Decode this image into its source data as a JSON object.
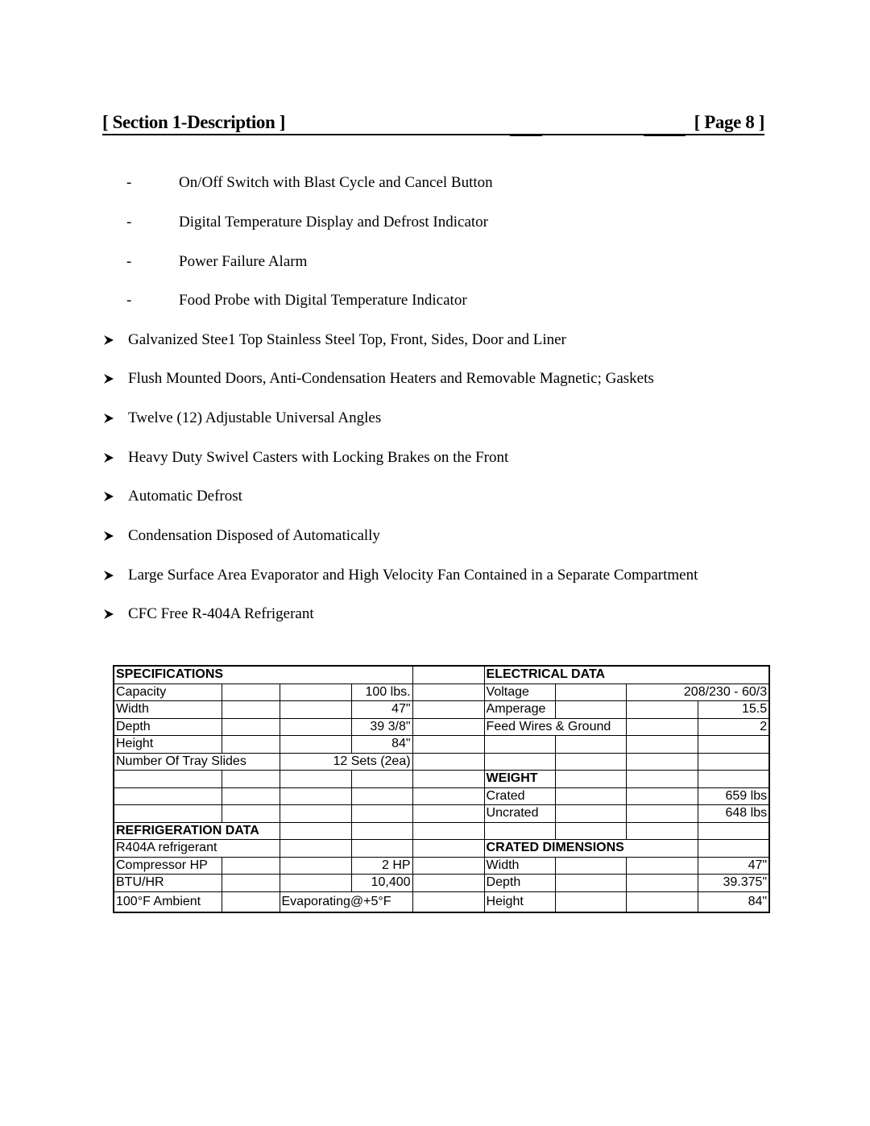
{
  "header": {
    "section": "[ Section 1-Description ]",
    "page": "[ Page 8 ]"
  },
  "sub_features": [
    "On/Off Switch with Blast Cycle and Cancel Button",
    "Digital Temperature Display and Defrost Indicator",
    "Power Failure Alarm",
    "Food Probe with Digital Temperature Indicator"
  ],
  "sub_feature_marker": "-",
  "features": [
    "Galvanized Stee1 Top Stainless Steel Top, Front, Sides, Door and Liner",
    "Flush Mounted Doors, Anti-Condensation Heaters and Removable Magnetic; Gaskets",
    "Twelve (12) Adjustable Universal Angles",
    "Heavy Duty Swivel Casters with Locking Brakes on the Front",
    "Automatic Defrost",
    "Condensation Disposed of Automatically",
    "Large Surface Area Evaporator and High Velocity Fan Contained in a Separate Compartment",
    "CFC Free R-404A Refrigerant"
  ],
  "feature_marker_icon": "arrowhead-bullet-icon",
  "table": {
    "specifications": {
      "title": "SPECIFICATIONS",
      "rows": [
        {
          "label": "Capacity",
          "value": "100 lbs."
        },
        {
          "label": "Width",
          "value": "47\""
        },
        {
          "label": "Depth",
          "value": "39 3/8\""
        },
        {
          "label": "Height",
          "value": "84\""
        },
        {
          "label": "Number Of Tray Slides",
          "value": "12 Sets (2ea)"
        }
      ]
    },
    "refrigeration": {
      "title": "REFRIGERATION DATA",
      "refrigerant": "R404A refrigerant",
      "rows": [
        {
          "label": "Compressor HP",
          "value": "2 HP"
        },
        {
          "label": "BTU/HR",
          "value": "10,400"
        },
        {
          "label": "100°F Ambient",
          "value": "Evaporating@+5°F"
        }
      ]
    },
    "electrical": {
      "title": "ELECTRICAL DATA",
      "rows": [
        {
          "label": "Voltage",
          "value": "208/230  - 60/3"
        },
        {
          "label": "Amperage",
          "value": "15.5"
        },
        {
          "label": "Feed Wires & Ground",
          "value": "2"
        }
      ]
    },
    "weight": {
      "title": "WEIGHT",
      "rows": [
        {
          "label": "Crated",
          "value": "659 lbs"
        },
        {
          "label": "Uncrated",
          "value": "648 lbs"
        }
      ]
    },
    "crated_dimensions": {
      "title": "CRATED DIMENSIONS",
      "rows": [
        {
          "label": "Width",
          "value": "47\""
        },
        {
          "label": "Depth",
          "value": "39.375\""
        },
        {
          "label": "Height",
          "value": "84\""
        }
      ]
    }
  }
}
